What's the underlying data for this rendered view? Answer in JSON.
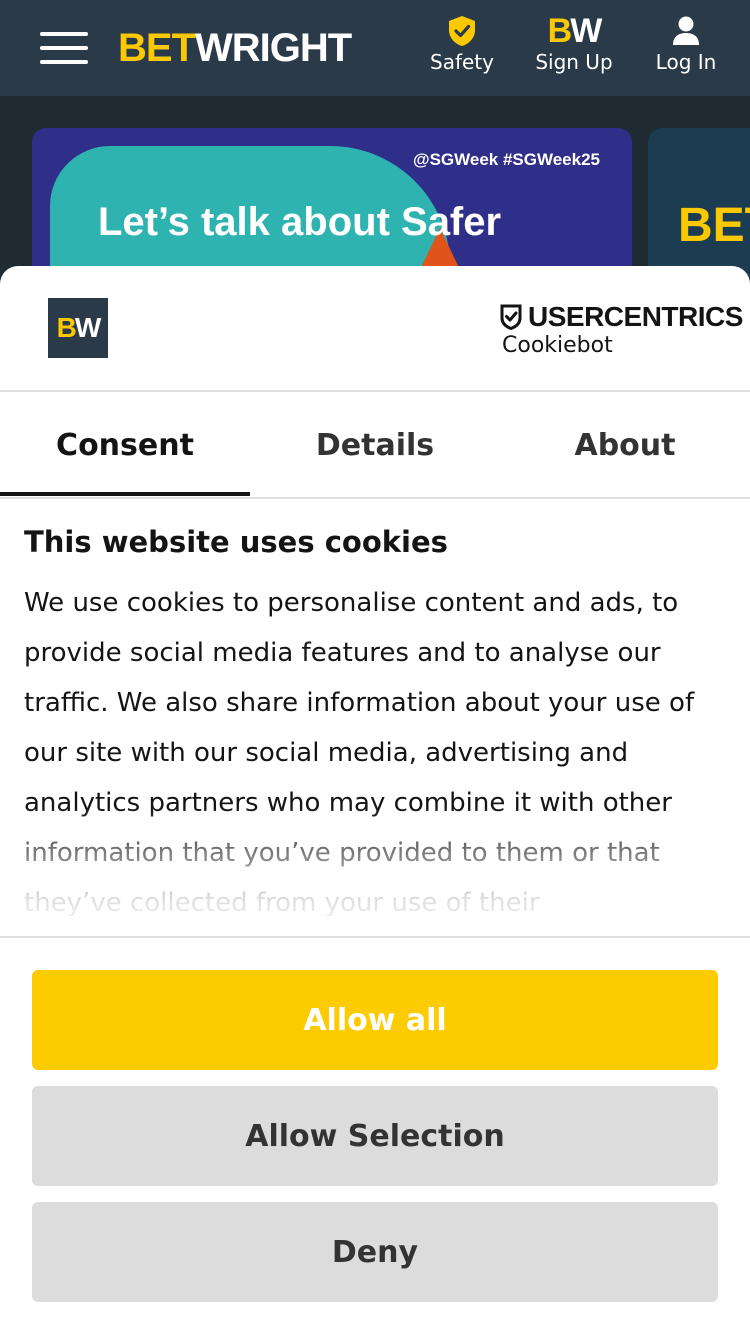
{
  "header": {
    "brand_part1": "BET",
    "brand_part2": "WRIGHT",
    "nav": {
      "safety": "Safety",
      "signup": "Sign Up",
      "login": "Log In"
    },
    "signup_icon_b": "B",
    "signup_icon_w": "W"
  },
  "promo": {
    "tag": "@SGWeek #SGWeek25",
    "headline": "Let’s talk about Safer",
    "side_text": "BET"
  },
  "dialog": {
    "logo_b": "B",
    "logo_w": "W",
    "provider_name": "USERCENTRICS",
    "provider_product": "Cookiebot",
    "tabs": [
      "Consent",
      "Details",
      "About"
    ],
    "active_tab": "Consent",
    "title": "This website uses cookies",
    "body": "We use cookies to personalise content and ads, to provide social media features and to analyse our traffic. We also share information about your use of our site with our social media, advertising and analytics partners who may combine it with other information that you’ve provided to them or that they’ve collected from your use of their",
    "buttons": {
      "allow_all": "Allow all",
      "allow_selection": "Allow Selection",
      "deny": "Deny"
    }
  },
  "colors": {
    "brand_yellow": "#fcc900",
    "header_bg": "#2a3a48",
    "allow_button": "#fccb00",
    "secondary_button": "#dcdcdc"
  },
  "icons": [
    "hamburger-menu-icon",
    "shield-check-icon",
    "bw-logo-icon",
    "user-icon",
    "usercentrics-shield-icon"
  ]
}
